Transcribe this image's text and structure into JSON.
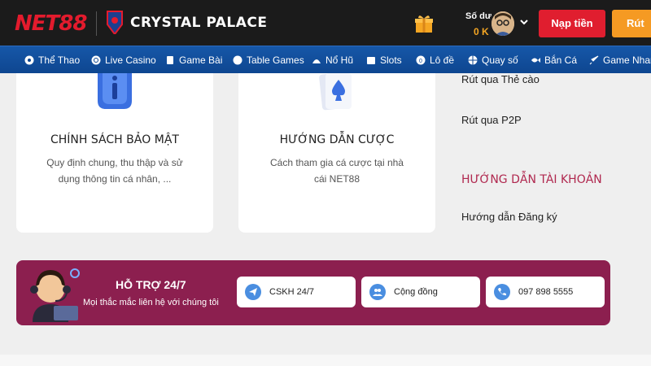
{
  "header": {
    "logo": "NET88",
    "partner": "CRYSTAL PALACE",
    "balance_label": "Số dư",
    "balance_value": "0 K",
    "deposit_label": "Nạp tiền",
    "withdraw_label": "Rút tiền"
  },
  "nav": {
    "items": [
      {
        "label": "Thể Thao",
        "icon": "soccer-ball-icon"
      },
      {
        "label": "Live Casino",
        "icon": "casino-chip-icon"
      },
      {
        "label": "Game Bài",
        "icon": "cards-icon"
      },
      {
        "label": "Table Games",
        "icon": "table-chip-icon"
      },
      {
        "label": "Nổ Hũ",
        "icon": "jackpot-icon"
      },
      {
        "label": "Slots",
        "icon": "slot-machine-icon"
      },
      {
        "label": "Lô đề",
        "icon": "lottery-ball-icon"
      },
      {
        "label": "Quay số",
        "icon": "spin-wheel-icon"
      },
      {
        "label": "Bắn Cá",
        "icon": "fish-icon"
      },
      {
        "label": "Game Nhanh",
        "icon": "rocket-icon"
      }
    ]
  },
  "cards": [
    {
      "title": "CHÍNH SÁCH BẢO MẬT",
      "desc": "Quy định chung, thu thập và sử dụng thông tin cá nhân, ...",
      "icon": "info-shield-icon"
    },
    {
      "title": "HƯỚNG DẪN CƯỢC",
      "desc": "Cách tham gia cá cược tại nhà cái NET88",
      "icon": "spade-card-icon"
    }
  ],
  "right_column": {
    "link1": "Rút qua Thẻ cào",
    "link2": "Rút qua P2P",
    "heading": "HƯỚNG DẪN TÀI KHOẢN",
    "link3": "Hướng dẫn Đăng ký"
  },
  "support": {
    "title": "HỖ TRỢ 24/7",
    "subtitle": "Mọi thắc mắc liên hệ với chúng tôi",
    "buttons": [
      {
        "label": "CSKH 24/7",
        "icon": "telegram-icon"
      },
      {
        "label": "Cộng đồng",
        "icon": "community-icon"
      },
      {
        "label": "097 898 5555",
        "icon": "phone-icon"
      }
    ]
  },
  "colors": {
    "brand_red": "#e01e2f",
    "nav_blue": "#1657a8",
    "support_maroon": "#8c1f4f",
    "withdraw_orange": "#f59a23"
  }
}
